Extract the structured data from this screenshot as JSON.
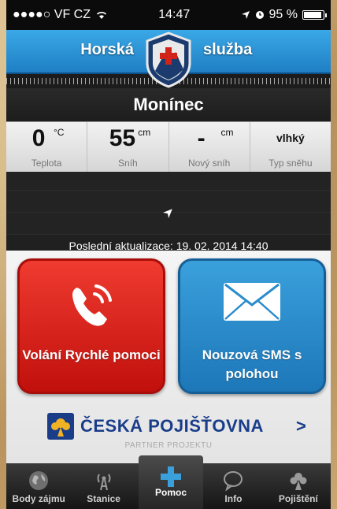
{
  "statusbar": {
    "carrier": "●●●●○ VF CZ",
    "time": "14:47",
    "battery": "95 %",
    "battery_level": 0.95
  },
  "header": {
    "title_left": "Horská",
    "title_right": "služba"
  },
  "location": {
    "name": "Monínec"
  },
  "stats": {
    "temperature": {
      "value": "0",
      "unit": "°C",
      "label": "Teplota"
    },
    "snow": {
      "value": "55",
      "unit": "cm",
      "label": "Sníh"
    },
    "new_snow": {
      "value": "-",
      "unit": "cm",
      "label": "Nový sníh"
    },
    "snow_type": {
      "value": "vlhký",
      "label": "Typ sněhu"
    }
  },
  "update": {
    "text": "Poslední aktualizace: 19. 02. 2014 14:40"
  },
  "actions": {
    "call": {
      "label": "Volání Rychlé pomoci"
    },
    "sms": {
      "label": "Nouzová SMS s polohou"
    }
  },
  "partner": {
    "name": "ČESKÁ POJIŠŤOVNA",
    "chevron": ">",
    "subtitle": "PARTNER PROJEKTU"
  },
  "tabs": [
    {
      "label": "Body zájmu",
      "icon": "globe-icon"
    },
    {
      "label": "Stanice",
      "icon": "antenna-icon"
    },
    {
      "label": "Pomoc",
      "icon": "cross-icon"
    },
    {
      "label": "Info",
      "icon": "speech-bubble-icon"
    },
    {
      "label": "Pojištění",
      "icon": "flower-icon"
    }
  ],
  "colors": {
    "header_blue": "#2a92d4",
    "call_red": "#d9241b",
    "sms_blue": "#2a8ccc",
    "partner_blue": "#1a3d8a"
  }
}
